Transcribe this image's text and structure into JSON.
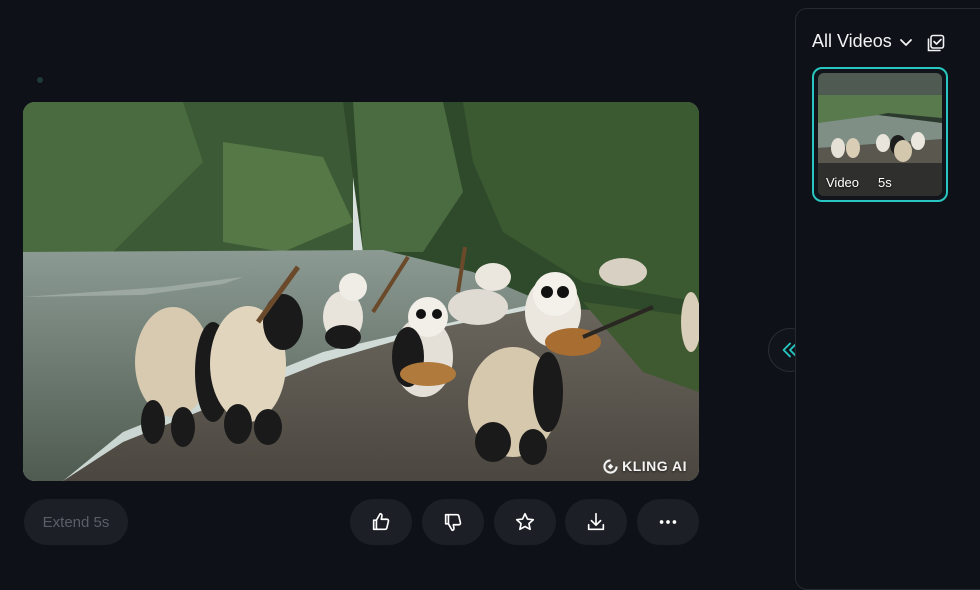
{
  "main": {
    "watermark_text": "KLING AI",
    "extend_label": "Extend 5s",
    "actions": [
      {
        "icon": "thumbs-up-icon"
      },
      {
        "icon": "thumbs-down-icon"
      },
      {
        "icon": "star-icon"
      },
      {
        "icon": "download-icon"
      },
      {
        "icon": "more-icon"
      }
    ]
  },
  "panel": {
    "filter_label": "All Videos",
    "items": [
      {
        "type_label": "Video",
        "duration": "5s"
      }
    ]
  },
  "colors": {
    "background": "#0e1117",
    "accent": "#28c6c0",
    "button_bg": "#1c1f26"
  }
}
